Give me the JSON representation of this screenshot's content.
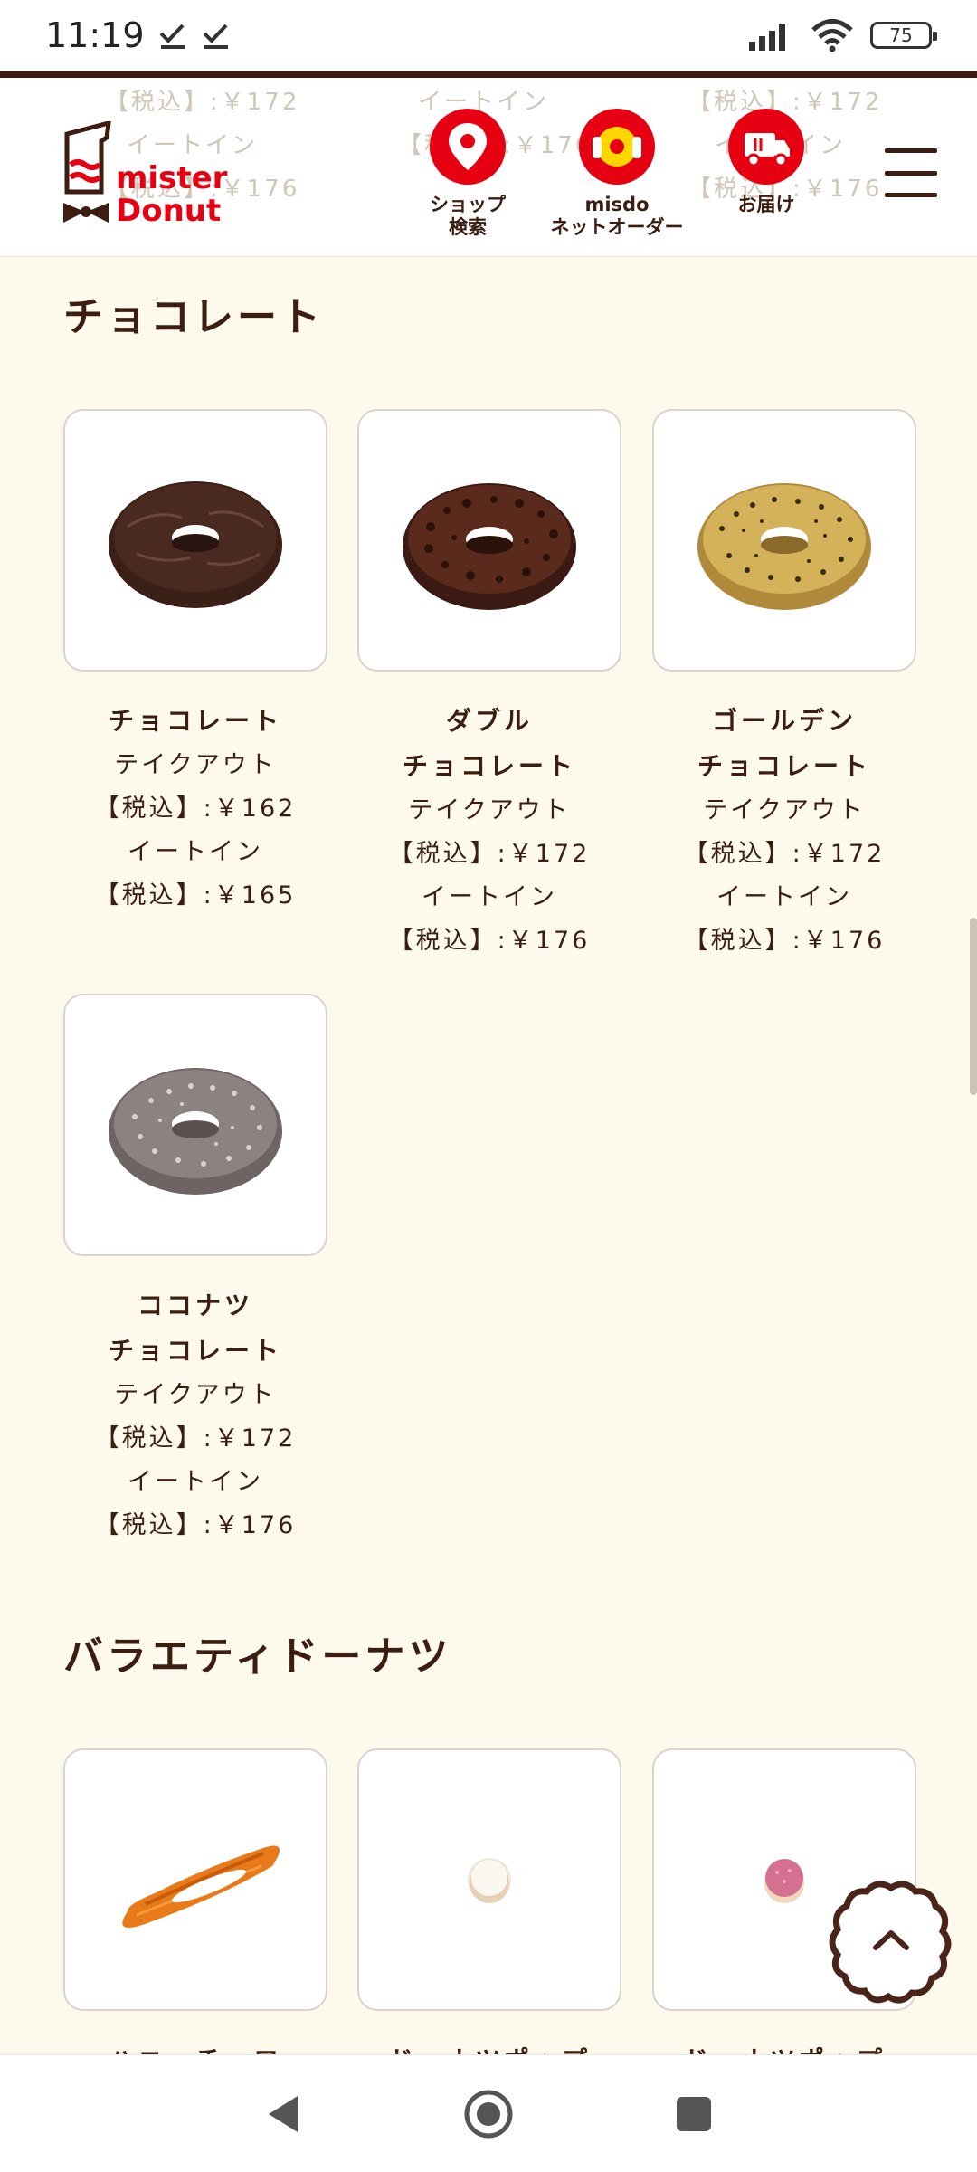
{
  "status_bar": {
    "time": "11:19",
    "battery": "75"
  },
  "header": {
    "ghost_texts": [
      "【税込】:￥172",
      "イートイン",
      "【税込】:￥176",
      "イートイン",
      "【税込】:￥176",
      "【税込】:￥172",
      "イートイン",
      "【税込】:￥176"
    ],
    "nav": [
      {
        "label": "ショップ\n検索"
      },
      {
        "label": "misdo\nネットオーダー"
      },
      {
        "label": "お届け"
      }
    ]
  },
  "sections": [
    {
      "title": "チョコレート",
      "items": [
        {
          "name": "チョコレート",
          "takeout_label": "テイクアウト",
          "takeout_price": "【税込】:￥162",
          "eatin_label": "イートイン",
          "eatin_price": "【税込】:￥165"
        },
        {
          "name": "ダブル\nチョコレート",
          "takeout_label": "テイクアウト",
          "takeout_price": "【税込】:￥172",
          "eatin_label": "イートイン",
          "eatin_price": "【税込】:￥176"
        },
        {
          "name": "ゴールデン\nチョコレート",
          "takeout_label": "テイクアウト",
          "takeout_price": "【税込】:￥172",
          "eatin_label": "イートイン",
          "eatin_price": "【税込】:￥176"
        },
        {
          "name": "ココナツ\nチョコレート",
          "takeout_label": "テイクアウト",
          "takeout_price": "【税込】:￥172",
          "eatin_label": "イートイン",
          "eatin_price": "【税込】:￥176"
        }
      ]
    },
    {
      "title": "バラエティドーナツ",
      "items": [
        {
          "name": "ハニーチュロ"
        },
        {
          "name": "ドーナツポップ"
        },
        {
          "name": "ドーナツポップ"
        }
      ]
    }
  ]
}
